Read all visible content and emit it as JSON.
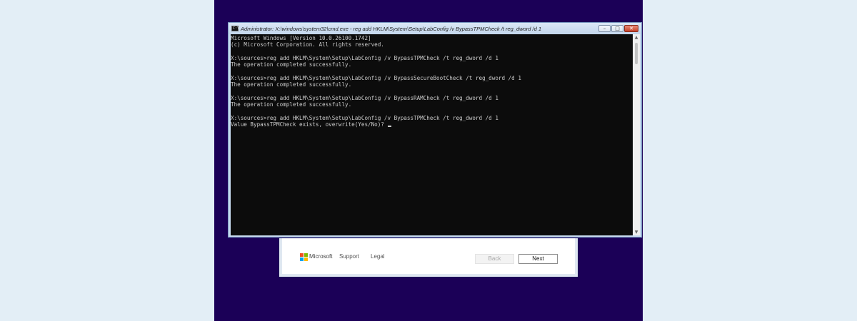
{
  "setup_dialog": {
    "brand": "Microsoft",
    "brand_logo_colors": [
      "#f25022",
      "#7fba00",
      "#00a4ef",
      "#ffb900"
    ],
    "support_link": "Support",
    "legal_link": "Legal",
    "back_button": "Back",
    "next_button": "Next"
  },
  "cmd_window": {
    "title": "Administrator: X:\\windows\\system32\\cmd.exe - reg  add HKLM\\System\\Setup\\LabConfig /v BypassTPMCheck /t reg_dword /d 1",
    "icon_text": "C:\\",
    "minimize": "–",
    "maximize": "□",
    "close": "✕",
    "lines": [
      "Microsoft Windows [Version 10.0.26100.1742]",
      "(c) Microsoft Corporation. All rights reserved.",
      "",
      "X:\\sources>reg add HKLM\\System\\Setup\\LabConfig /v BypassTPMCheck /t reg_dword /d 1",
      "The operation completed successfully.",
      "",
      "X:\\sources>reg add HKLM\\System\\Setup\\LabConfig /v BypassSecureBootCheck /t reg_dword /d 1",
      "The operation completed successfully.",
      "",
      "X:\\sources>reg add HKLM\\System\\Setup\\LabConfig /v BypassRAMCheck /t reg_dword /d 1",
      "The operation completed successfully.",
      "",
      "X:\\sources>reg add HKLM\\System\\Setup\\LabConfig /v BypassTPMCheck /t reg_dword /d 1"
    ],
    "prompt_line": "Value BypassTPMCheck exists, overwrite(Yes/No)? "
  }
}
